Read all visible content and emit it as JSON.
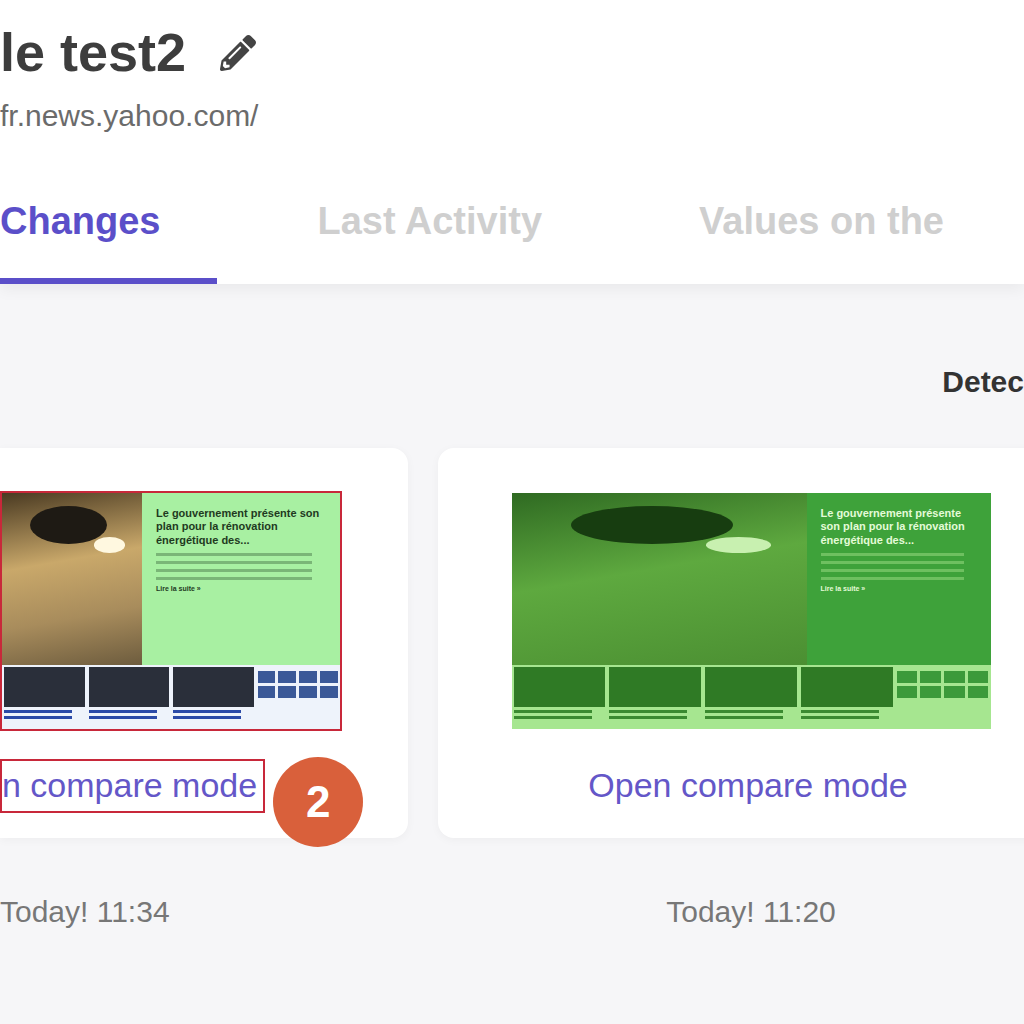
{
  "monitor": {
    "title": "le test2",
    "url": "fr.news.yahoo.com/"
  },
  "tabs": [
    {
      "label": "Changes",
      "selected": true
    },
    {
      "label": "Last Activity",
      "selected": false
    },
    {
      "label": "Values on the",
      "selected": false
    }
  ],
  "detected_label": "Detec",
  "changes": [
    {
      "link": "n compare mode",
      "time": "Today! 11:34",
      "highlighted": true,
      "tinted": false,
      "badge": "2",
      "snapshot": {
        "headline": "Le gouvernement présente son plan pour la rénovation énergétique des...",
        "more": "Lire la suite »"
      }
    },
    {
      "link": "Open compare mode",
      "time": "Today! 11:20",
      "highlighted": false,
      "tinted": true,
      "snapshot": {
        "headline": "Le gouvernement présente son plan pour la rénovation énergétique des...",
        "more": "Lire la suite »"
      }
    }
  ]
}
